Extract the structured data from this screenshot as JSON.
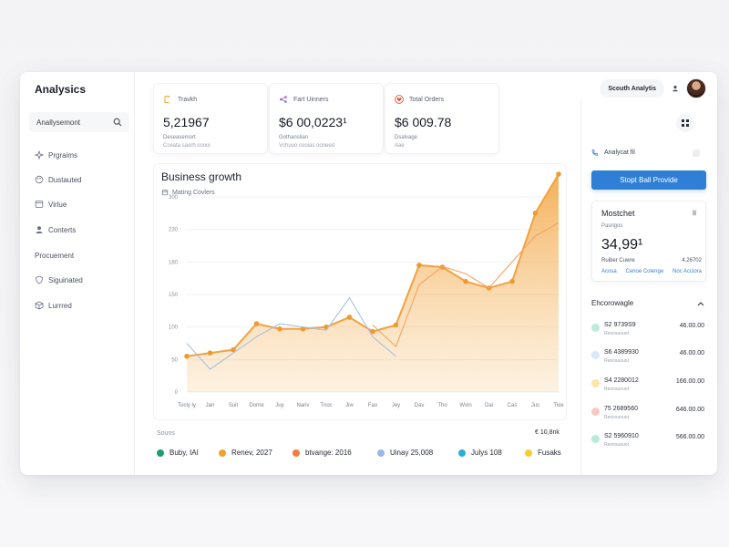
{
  "app": {
    "title": "Analysics"
  },
  "sidebar": {
    "search_label": "Anallysemont",
    "items": [
      {
        "label": "Prgraims",
        "icon": "sparkle-icon"
      },
      {
        "label": "Dustauted",
        "icon": "palette-icon"
      },
      {
        "label": "Virlue",
        "icon": "window-icon"
      },
      {
        "label": "Conterts",
        "icon": "user-icon"
      },
      {
        "label": "Procuement",
        "icon": ""
      },
      {
        "label": "Siguinated",
        "icon": "shield-icon"
      },
      {
        "label": "Lurrred",
        "icon": "cube-icon"
      }
    ]
  },
  "header": {
    "account_label": "Scouth Analytis"
  },
  "stats": [
    {
      "label": "Travkh",
      "value": "5,21967",
      "sub1": "Deseasemort",
      "sub2": "Cceata saorh cooui",
      "icon": "file-icon",
      "accent": "#f0b13a"
    },
    {
      "label": "Fart Uinners",
      "value": "$6 00,0223¹",
      "sub1": "Gothanslian",
      "sub2": "Vchuuo cooias ooneed",
      "icon": "share-icon",
      "accent": "#9b6bd8"
    },
    {
      "label": "Total Orders",
      "value": "$6 009.78",
      "sub1": "Dsalvage",
      "sub2": "Aae",
      "icon": "heart-icon",
      "accent": "#e0553b"
    }
  ],
  "chart_data": {
    "type": "area",
    "title": "Business growth",
    "subtitle": "Mating Covlers",
    "categories": [
      "Tocly ly",
      "Jan",
      "Suit",
      "Dorne",
      "Juy",
      "Nariv",
      "Tnoc",
      "Jiw",
      "Fao",
      "Jey",
      "Dav",
      "Tho",
      "Wvin",
      "Dai",
      "Cas",
      "Jus",
      "Tkie"
    ],
    "yticks": [
      "0",
      "50",
      "100",
      "150",
      "180",
      "230",
      "300"
    ],
    "ylim": [
      0,
      300
    ],
    "series": [
      {
        "name": "",
        "values": [
          55,
          60,
          65,
          105,
          97,
          97,
          100,
          115,
          93,
          103,
          195,
          192,
          170,
          160,
          170,
          275,
          335
        ],
        "fill": true,
        "color": "#f1a23f"
      },
      {
        "name": "",
        "values": [
          75,
          35,
          60,
          85,
          105,
          100,
          95,
          145,
          85,
          55,
          null,
          null,
          null,
          null,
          null,
          null,
          null
        ],
        "fill": false,
        "color": "#a9c1dd"
      },
      {
        "name": "",
        "values": [
          null,
          null,
          null,
          null,
          null,
          null,
          null,
          null,
          103,
          70,
          165,
          193,
          182,
          160,
          200,
          240,
          260
        ],
        "fill": false,
        "color": "#f3a463"
      }
    ]
  },
  "sources": {
    "label": "Souns",
    "right": "€ 10,8nk"
  },
  "legend": [
    {
      "label": "Buby, IAI",
      "color": "#1f9e6d"
    },
    {
      "label": "Renev, 2027",
      "color": "#eea42c"
    },
    {
      "label": "btvange: 2016",
      "color": "#ef7d3d"
    },
    {
      "label": "Uinay 25,008",
      "color": "#97b9e8"
    },
    {
      "label": "Julys 108",
      "color": "#2aaed6"
    },
    {
      "label": "Fusaks",
      "color": "#f1cf2e"
    }
  ],
  "right": {
    "analyze_label": "Analycat fil",
    "primary_button": "Stopt Ball Provide",
    "metric": {
      "title": "Mostchet",
      "small": "Pasrigos",
      "value": "34,99¹",
      "row_left": "Ruiber Cuwre",
      "row_right": "4.26702",
      "links": [
        "Acosa",
        "Cenoe Colenge",
        "Noc Acciora"
      ]
    },
    "section_title": "Ehcorowagle",
    "list": [
      {
        "code": "S2 9739S9",
        "desc": "Reoosuouot",
        "amount": "46.00.00",
        "color": "#bfe9d8"
      },
      {
        "code": "S6 4389930",
        "desc": "Reoosuouot",
        "amount": "46.00.00",
        "color": "#d9e7f8"
      },
      {
        "code": "S4 2280012",
        "desc": "Reoosuouot",
        "amount": "166.00.00",
        "color": "#fbe6a8"
      },
      {
        "code": "75 2689560",
        "desc": "Reoosuouot",
        "amount": "646.00.00",
        "color": "#f9c7c2"
      },
      {
        "code": "S2 5960910",
        "desc": "Reoosuouot",
        "amount": "566.00.00",
        "color": "#b7ead8"
      }
    ]
  }
}
